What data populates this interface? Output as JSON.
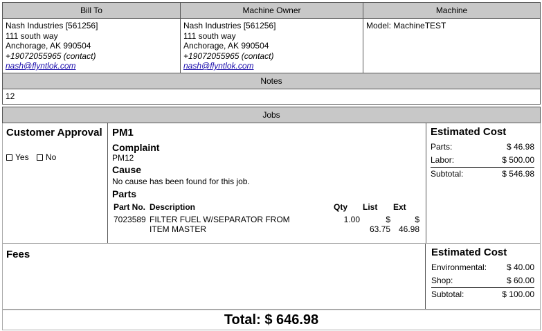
{
  "bill_to": {
    "header": "Bill To",
    "name": "Nash Industries [561256]",
    "street": "111 south way",
    "city": "Anchorage, AK 990504",
    "phone": "+19072055965 (contact)",
    "email": "nash@flyntlok.com"
  },
  "machine_owner": {
    "header": "Machine Owner",
    "name": "Nash Industries [561256]",
    "street": "111 south way",
    "city": "Anchorage, AK 990504",
    "phone": "+19072055965 (contact)",
    "email": "nash@flyntlok.com"
  },
  "machine": {
    "header": "Machine",
    "model": "Model: MachineTEST"
  },
  "notes": {
    "header": "Notes",
    "text": "12"
  },
  "jobs": {
    "header": "Jobs",
    "approval_title": "Customer Approval",
    "yes_label": "Yes",
    "no_label": "No",
    "job_title": "PM1",
    "complaint_label": "Complaint",
    "complaint_text": "PM12",
    "cause_label": "Cause",
    "cause_text": "No cause has been found for this job.",
    "parts_label": "Parts",
    "parts_columns": [
      "Part No.",
      "Description",
      "Qty",
      "List",
      "Ext"
    ],
    "parts_rows": [
      [
        "7023589",
        "FILTER FUEL W/SEPARATOR FROM ITEM MASTER",
        "1.00",
        "$ 63.75",
        "$ 46.98"
      ]
    ],
    "cost": {
      "title": "Estimated Cost",
      "parts_label": "Parts:",
      "parts_value": "$ 46.98",
      "labor_label": "Labor:",
      "labor_value": "$ 500.00",
      "subtotal_label": "Subtotal:",
      "subtotal_value": "$ 546.98"
    }
  },
  "fees": {
    "title": "Fees",
    "cost": {
      "title": "Estimated Cost",
      "env_label": "Environmental:",
      "env_value": "$ 40.00",
      "shop_label": "Shop:",
      "shop_value": "$ 60.00",
      "subtotal_label": "Subtotal:",
      "subtotal_value": "$ 100.00"
    }
  },
  "total": "Total: $ 646.98"
}
